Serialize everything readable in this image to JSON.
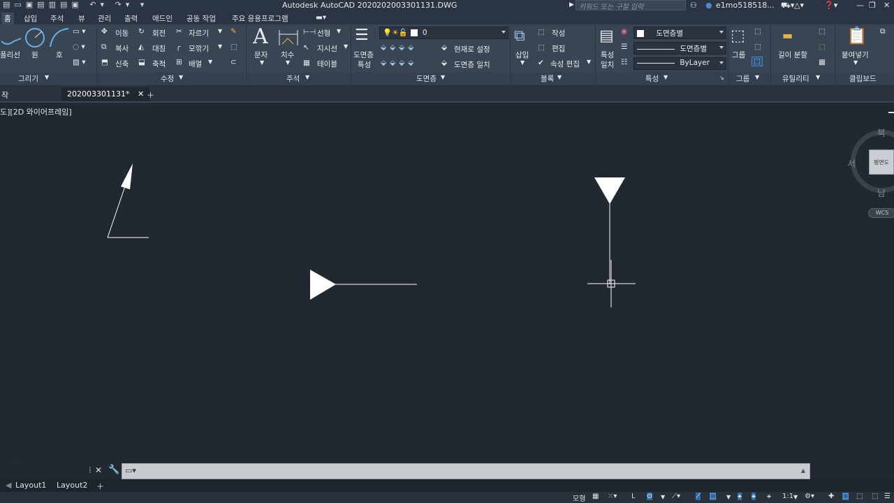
{
  "app": {
    "title": "Autodesk AutoCAD 2020",
    "filename": "202003301131.DWG",
    "search_placeholder": "키워드 또는 구절 입력",
    "user": "e1mo518518..."
  },
  "ribbon_tabs": [
    "홈",
    "삽입",
    "주석",
    "뷰",
    "관리",
    "출력",
    "애드인",
    "공동 작업",
    "주요 응용프로그램"
  ],
  "ribbon": {
    "draw": {
      "polyline": "폴리선",
      "circle": "원",
      "arc": "호",
      "panel": "그리기"
    },
    "modify": {
      "move": "이동",
      "rotate": "회전",
      "trim": "자르기",
      "copy": "복사",
      "mirror": "대칭",
      "fillet": "모깎기",
      "stretch": "신축",
      "scale": "축척",
      "array": "배열",
      "panel": "수정"
    },
    "annotation": {
      "text": "문자",
      "dimension": "치수",
      "linear": "선형",
      "leader": "지시선",
      "table": "테이블",
      "panel": "주석"
    },
    "layers": {
      "layer_properties_l1": "도면층",
      "layer_properties_l2": "특성",
      "current_layer": "0",
      "make_current": "현재로 설정",
      "match_layer": "도면층 일치",
      "panel": "도면층"
    },
    "block": {
      "insert": "삽입",
      "create": "작성",
      "edit": "편집",
      "edit_attributes": "속성 편집",
      "panel": "블록"
    },
    "properties": {
      "match_l1": "특성",
      "match_l2": "일치",
      "color": "도면층별",
      "linetype": "도면층별",
      "lineweight": "ByLayer",
      "panel": "특성"
    },
    "groups": {
      "group": "그룹",
      "panel": "그룹"
    },
    "utilities": {
      "measure": "길이 분할",
      "panel": "유틸리티"
    },
    "clipboard": {
      "paste": "붙여넣기",
      "panel": "클립보드"
    }
  },
  "doc_tabs": {
    "start": "작",
    "active": "202003301131*"
  },
  "viewport_label": "도][2D 와이어프레임]",
  "viewcube": {
    "north": "북",
    "west": "서",
    "south": "남",
    "face": "평면도",
    "wcs": "WCS"
  },
  "layout_tabs": [
    "Layout1",
    "Layout2"
  ],
  "statusbar": {
    "model": "모형",
    "scale": "1:1"
  },
  "colors": {
    "background": "#212830",
    "ribbon": "#3a4554",
    "accent": "#2f6aa8",
    "geometry": "#ffffff"
  }
}
